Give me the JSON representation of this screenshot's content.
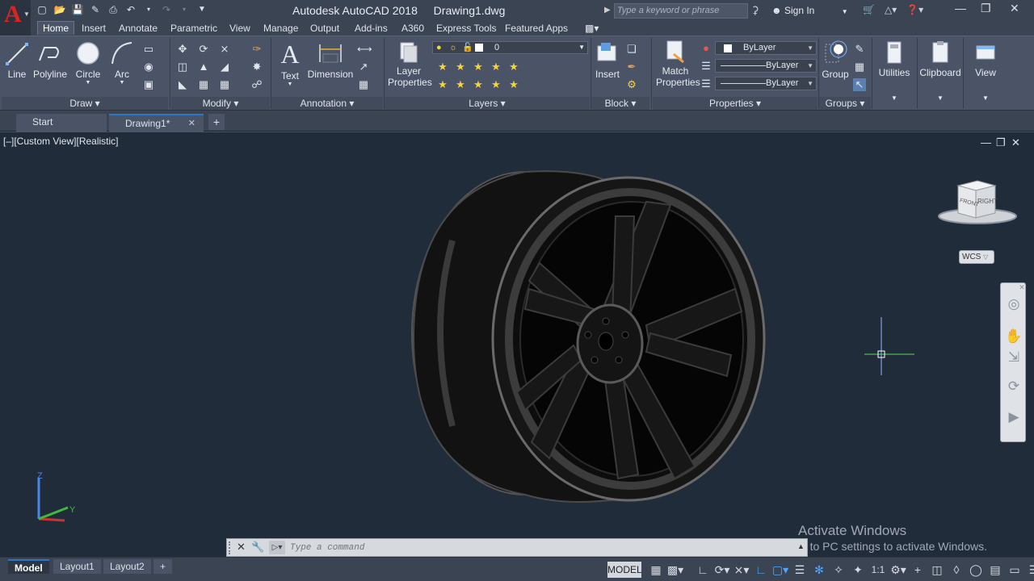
{
  "app": {
    "title": "Autodesk AutoCAD 2018",
    "document": "Drawing1.dwg",
    "search_placeholder": "Type a keyword or phrase",
    "sign_in": "Sign In"
  },
  "ribbon_tabs": [
    "Home",
    "Insert",
    "Annotate",
    "Parametric",
    "View",
    "Manage",
    "Output",
    "Add-ins",
    "A360",
    "Express Tools",
    "Featured Apps"
  ],
  "draw": {
    "title": "Draw",
    "line": "Line",
    "polyline": "Polyline",
    "circle": "Circle",
    "arc": "Arc"
  },
  "modify": {
    "title": "Modify"
  },
  "annotation": {
    "title": "Annotation",
    "text": "Text",
    "dimension": "Dimension"
  },
  "layers": {
    "title": "Layers",
    "layer_properties_1": "Layer",
    "layer_properties_2": "Properties",
    "current_layer": "0"
  },
  "block": {
    "title": "Block",
    "insert": "Insert"
  },
  "properties": {
    "title": "Properties",
    "match_1": "Match",
    "match_2": "Properties",
    "color": "ByLayer",
    "linetype": "ByLayer",
    "lineweight": "ByLayer"
  },
  "groups": {
    "title": "Groups",
    "group": "Group"
  },
  "utilities": "Utilities",
  "clipboard": "Clipboard",
  "view": "View",
  "file_tabs": {
    "start": "Start",
    "drawing": "Drawing1*"
  },
  "viewport": {
    "label": "[–][Custom View][Realistic]",
    "wcs": "WCS",
    "cube_front": "FRONT",
    "cube_right": "RIGHT",
    "ucs_z": "Z",
    "ucs_y": "Y"
  },
  "watermark": {
    "line1": "Activate Windows",
    "line2": "Go to PC settings to activate Windows."
  },
  "command": {
    "placeholder": "Type a command"
  },
  "layout_tabs": [
    "Model",
    "Layout1",
    "Layout2"
  ],
  "status": {
    "model": "MODEL",
    "scale": "1:1"
  },
  "colors": {
    "accent": "#2a77c9",
    "logo_red": "#d9251d",
    "background": "#212c3b"
  }
}
